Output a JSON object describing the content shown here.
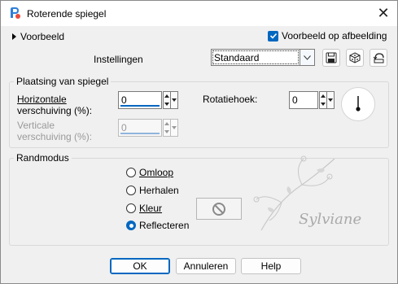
{
  "window": {
    "title": "Roterende spiegel",
    "close_label": "✕"
  },
  "top": {
    "preview_toggle_label": "Voorbeeld",
    "preview_on_image_label": "Voorbeeld op afbeelding",
    "preview_on_image_checked": true,
    "settings_label": "Instellingen",
    "preset_value": "Standaard"
  },
  "placement": {
    "title": "Plaatsing van spiegel",
    "horizontal_label_line1": "Horizontale",
    "horizontal_label_line2": "verschuiving (%):",
    "horizontal_value": "0",
    "vertical_label_line1": "Verticale",
    "vertical_label_line2": "verschuiving (%):",
    "vertical_value": "0",
    "rotation_label": "Rotatiehoek:",
    "rotation_value": "0"
  },
  "edge_mode": {
    "title": "Randmodus",
    "options": [
      {
        "label": "Omloop",
        "selected": false
      },
      {
        "label": "Herhalen",
        "selected": false
      },
      {
        "label": "Kleur",
        "selected": false
      },
      {
        "label": "Reflecteren",
        "selected": true
      }
    ]
  },
  "watermark": {
    "text": "Sylviane"
  },
  "buttons": {
    "ok": "OK",
    "cancel": "Annuleren",
    "help": "Help"
  },
  "colors": {
    "accent": "#0067c0"
  }
}
